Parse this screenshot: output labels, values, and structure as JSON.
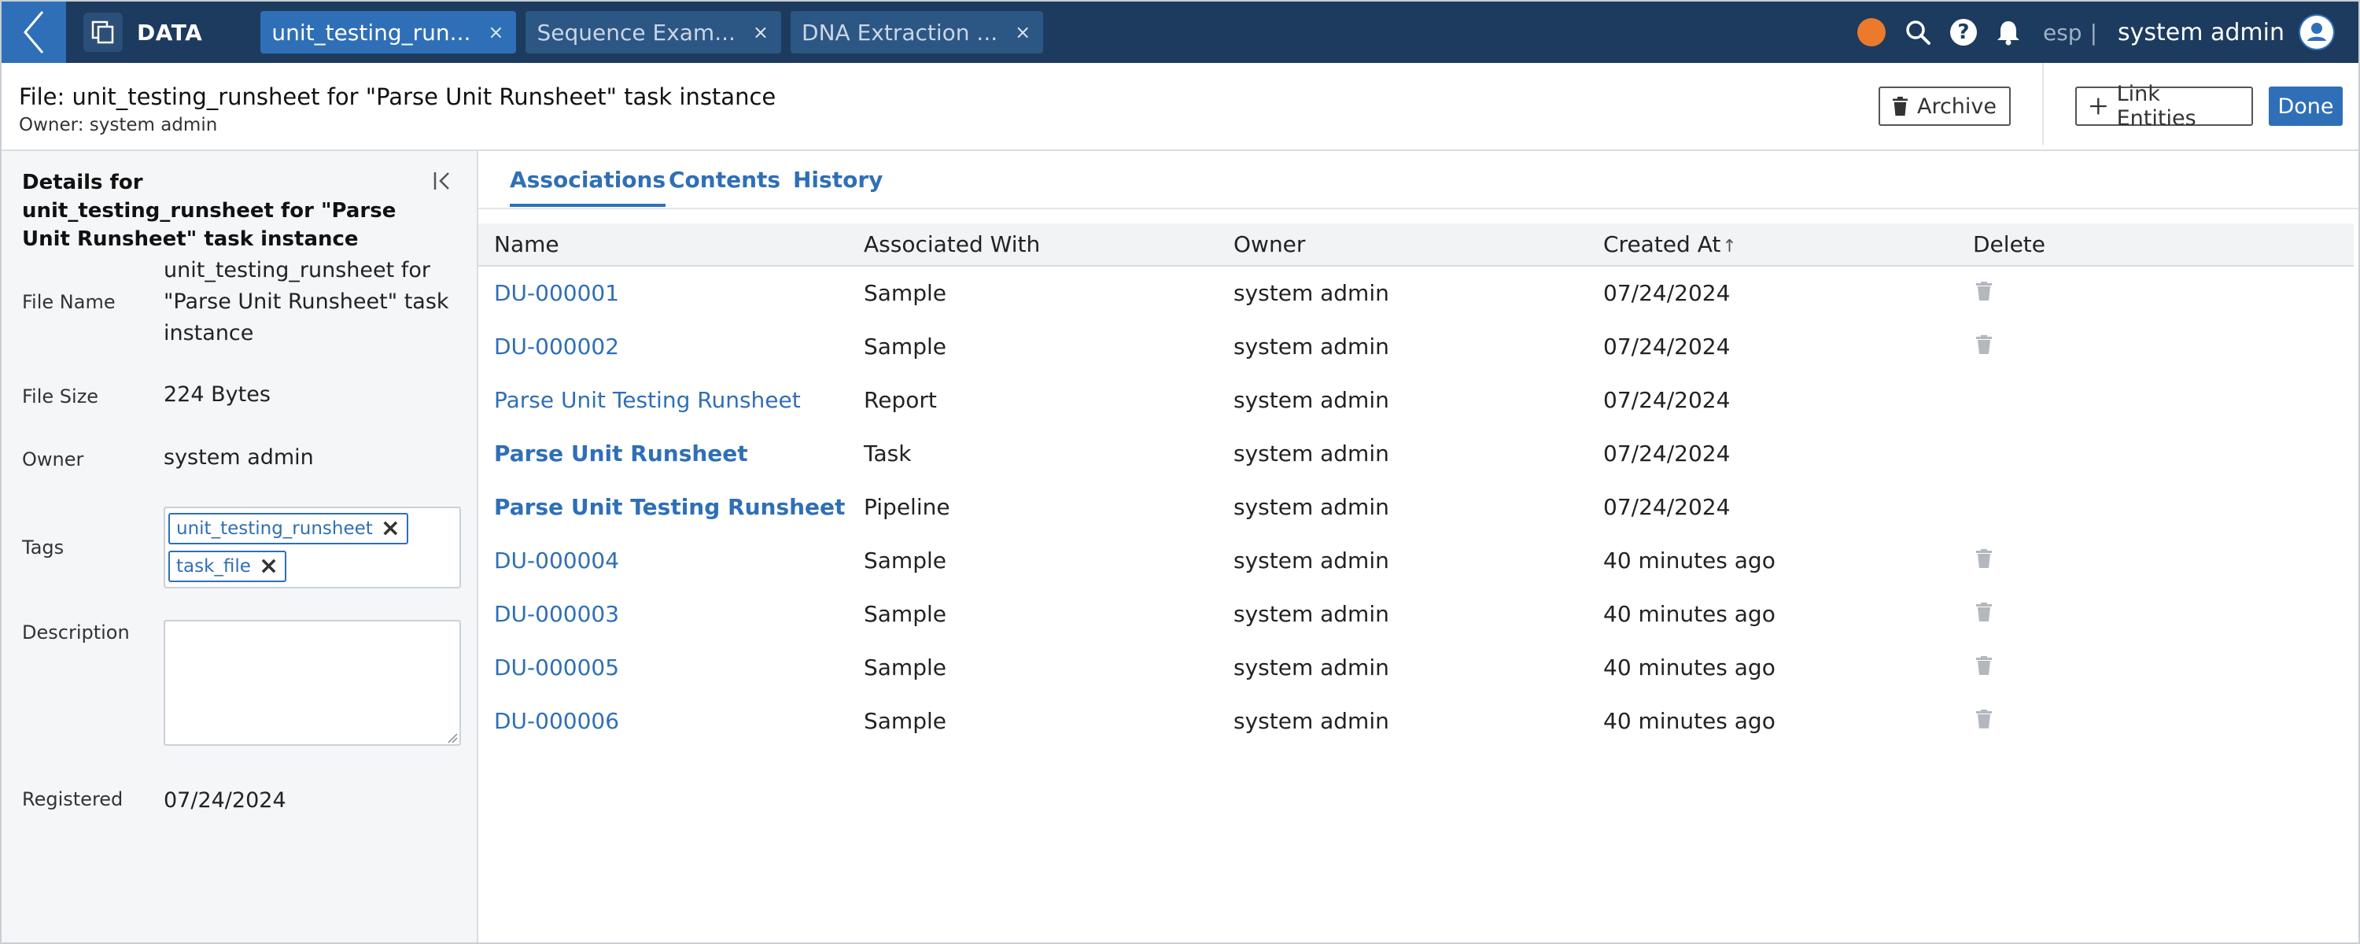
{
  "topbar": {
    "app_title": "DATA",
    "tabs": [
      {
        "label": "unit_testing_run...",
        "close": "×"
      },
      {
        "label": "Sequence Exam...",
        "close": "×"
      },
      {
        "label": "DNA Extraction ...",
        "close": "×"
      }
    ],
    "lang": "esp",
    "separator": "|",
    "user_name": "system admin",
    "help": "?",
    "status_dot_color": "#ec7a2a"
  },
  "header": {
    "title": "File: unit_testing_runsheet for \"Parse Unit Runsheet\" task instance",
    "owner": "Owner: system admin",
    "archive_label": "Archive",
    "link_entities_label": "Link Entities",
    "done_label": "Done"
  },
  "details": {
    "title": "Details for unit_testing_runsheet for \"Parse Unit Runsheet\" task instance",
    "file_name_label": "File Name",
    "file_name": "unit_testing_runsheet for \"Parse Unit Runsheet\" task instance",
    "file_size_label": "File Size",
    "file_size": "224 Bytes",
    "owner_label": "Owner",
    "owner": "system admin",
    "tags_label": "Tags",
    "tags": [
      "unit_testing_runsheet",
      "task_file"
    ],
    "description_label": "Description",
    "description": "",
    "registered_label": "Registered",
    "registered": "07/24/2024"
  },
  "main_tabs": [
    "Associations",
    "Contents",
    "History"
  ],
  "table": {
    "columns": [
      "Name",
      "Associated With",
      "Owner",
      "Created At",
      "Delete"
    ],
    "sort_indicator": "↑",
    "rows": [
      {
        "name": "DU-000001",
        "associated": "Sample",
        "owner": "system admin",
        "created": "07/24/2024"
      },
      {
        "name": "DU-000002",
        "associated": "Sample",
        "owner": "system admin",
        "created": "07/24/2024"
      },
      {
        "name": "Parse Unit Testing Runsheet",
        "associated": "Report",
        "owner": "system admin",
        "created": "07/24/2024"
      },
      {
        "name": "Parse Unit Runsheet",
        "associated": "Task",
        "owner": "system admin",
        "created": "07/24/2024"
      },
      {
        "name": "Parse Unit Testing Runsheet",
        "associated": "Pipeline",
        "owner": "system admin",
        "created": "07/24/2024"
      },
      {
        "name": "DU-000004",
        "associated": "Sample",
        "owner": "system admin",
        "created": "40 minutes ago"
      },
      {
        "name": "DU-000003",
        "associated": "Sample",
        "owner": "system admin",
        "created": "40 minutes ago"
      },
      {
        "name": "DU-000005",
        "associated": "Sample",
        "owner": "system admin",
        "created": "40 minutes ago"
      },
      {
        "name": "DU-000006",
        "associated": "Sample",
        "owner": "system admin",
        "created": "40 minutes ago"
      }
    ]
  },
  "colors": {
    "topbar_bg": "#1c3b5e",
    "accent": "#2f6fb7",
    "panel_bg": "#f5f6f8"
  }
}
